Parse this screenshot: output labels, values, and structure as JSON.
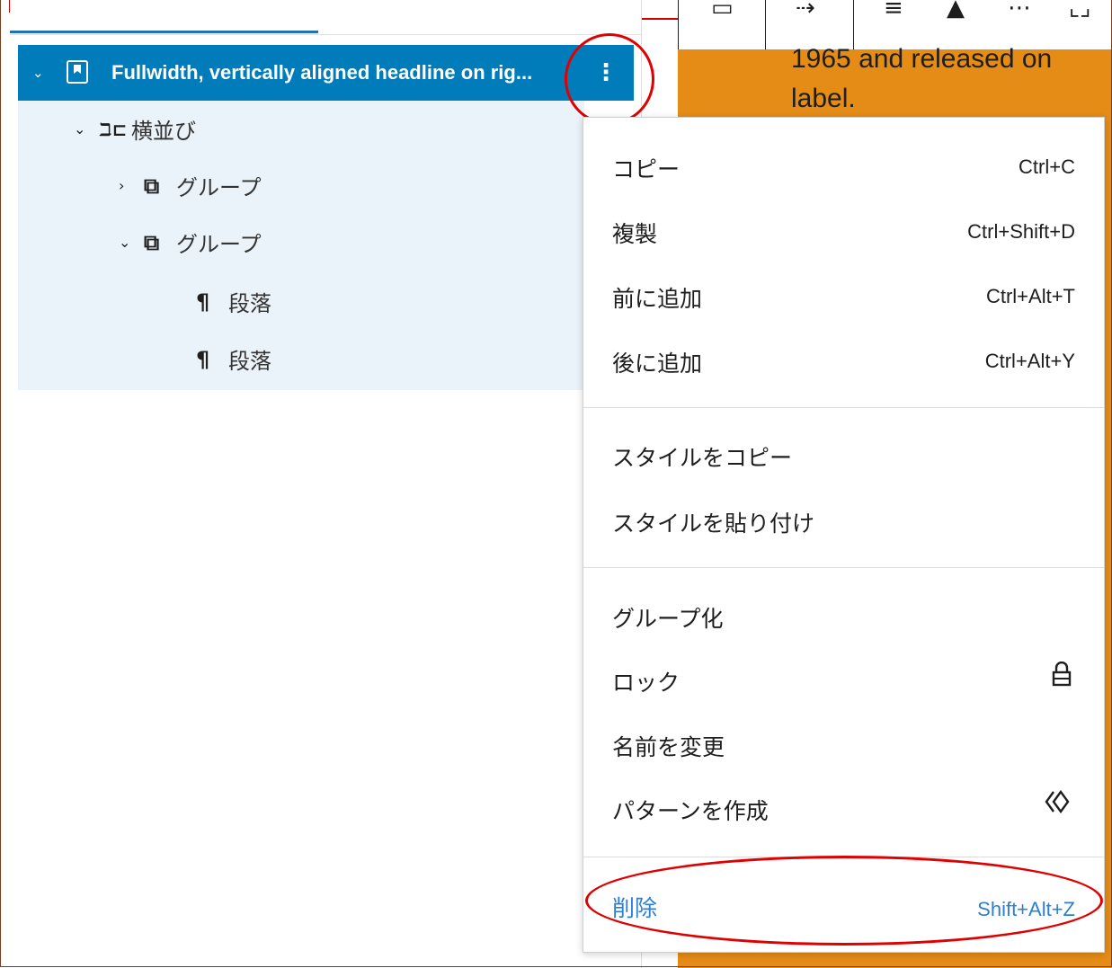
{
  "list_view": {
    "selected_row": {
      "title": "Fullwidth, vertically aligned headline on rig...",
      "options_glyph": "⋮"
    },
    "tree": [
      {
        "label": "横並び",
        "icon": "row-icon",
        "icon_glyph": "ℶ⊏",
        "expanded": true
      },
      {
        "label": "グループ",
        "icon": "group-icon",
        "icon_glyph": "⧉",
        "expanded": false
      },
      {
        "label": "グループ",
        "icon": "group-icon",
        "icon_glyph": "⧉",
        "expanded": true
      },
      {
        "label": "段落",
        "icon": "paragraph-icon",
        "icon_glyph": "¶"
      },
      {
        "label": "段落",
        "icon": "paragraph-icon",
        "icon_glyph": "¶"
      }
    ]
  },
  "canvas": {
    "text_lines": [
      "1965 and released on",
      "label."
    ],
    "background_color": "#e58c17"
  },
  "menu": {
    "section1": [
      {
        "label": "コピー",
        "shortcut": "Ctrl+C"
      },
      {
        "label": "複製",
        "shortcut": "Ctrl+Shift+D"
      },
      {
        "label": "前に追加",
        "shortcut": "Ctrl+Alt+T"
      },
      {
        "label": "後に追加",
        "shortcut": "Ctrl+Alt+Y"
      }
    ],
    "section2": [
      {
        "label": "スタイルをコピー"
      },
      {
        "label": "スタイルを貼り付け"
      }
    ],
    "section3": [
      {
        "label": "グループ化"
      },
      {
        "label": "ロック",
        "icon": "lock-icon"
      },
      {
        "label": "名前を変更"
      },
      {
        "label": "パターンを作成",
        "icon": "pattern-icon"
      }
    ],
    "section4": [
      {
        "label": "削除",
        "shortcut": "Shift+Alt+Z"
      }
    ]
  },
  "colors": {
    "accent": "#007cba",
    "annotation": "#e00000",
    "danger_text": "#2d7fd3"
  }
}
